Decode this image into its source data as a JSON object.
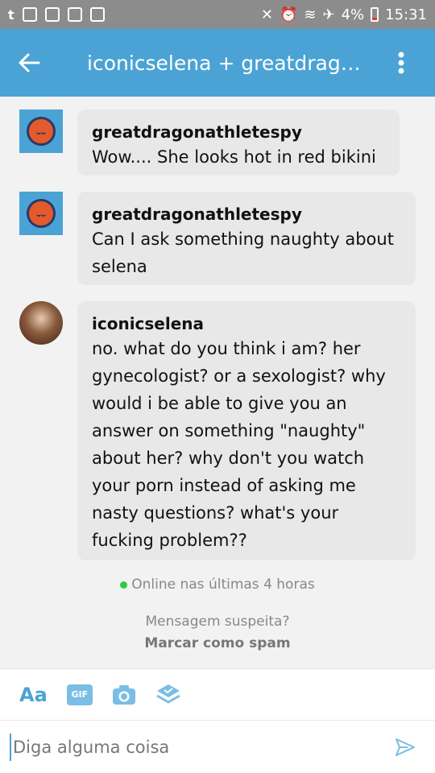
{
  "status_bar": {
    "battery_percent": "4%",
    "time": "15:31"
  },
  "header": {
    "title": "iconicselena + greatdrago..."
  },
  "messages": [
    {
      "sender": "greatdragonathletespy",
      "text": "Wow.... She looks hot in red bikini"
    },
    {
      "sender": "greatdragonathletespy",
      "text": "Can I ask something naughty about selena"
    },
    {
      "sender": "iconicselena",
      "text": "no. what do you think i am? her gynecologist? or a sexologist? why would i be able to give you an answer on something \"naughty\" about her? why don't you watch your porn instead of asking me nasty questions? what's your fucking problem??"
    }
  ],
  "status": {
    "online": "Online nas últimas 4 horas",
    "spam_question": "Mensagem suspeita?",
    "spam_action": "Marcar como spam"
  },
  "toolbar": {
    "text_style_label": "Aa",
    "gif_label": "GIF"
  },
  "input": {
    "placeholder": "Diga alguma coisa"
  },
  "colors": {
    "accent": "#4aa3d4",
    "online_dot": "#2ecc40",
    "bubble": "#e8e8e8"
  }
}
